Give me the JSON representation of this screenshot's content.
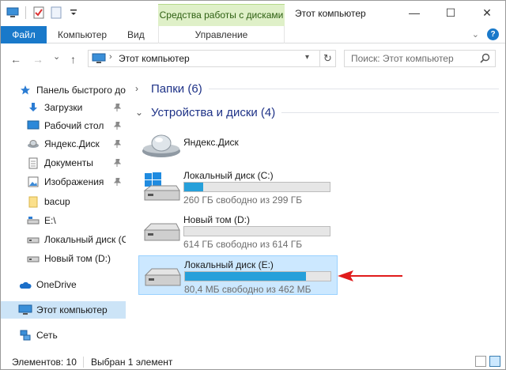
{
  "window": {
    "title": "Этот компьютер",
    "minimize": "—",
    "maximize": "☐",
    "close": "✕"
  },
  "quick_access_toolbar": {
    "icons": [
      "computer-icon",
      "properties-icon",
      "new-folder-icon",
      "customize-dropdown-icon"
    ]
  },
  "ribbon": {
    "contextual_group": "Средства работы с дисками",
    "tabs": {
      "file": "Файл",
      "computer": "Компьютер",
      "view": "Вид",
      "manage": "Управление"
    },
    "accent_color": "#1979ca",
    "contextual_color": "#dff0c8"
  },
  "navigation": {
    "back": "←",
    "forward": "→",
    "recent": "⌄",
    "up": "↑",
    "address": "Этот компьютер",
    "separator": "›",
    "refresh": "↻",
    "search_placeholder": "Поиск: Этот компьютер"
  },
  "sidebar": {
    "items": [
      {
        "label": "Панель быстрого до",
        "icon": "star-icon",
        "pinned": false
      },
      {
        "label": "Загрузки",
        "icon": "downloads-icon",
        "pinned": true
      },
      {
        "label": "Рабочий стол",
        "icon": "desktop-icon",
        "pinned": true
      },
      {
        "label": "Яндекс.Диск",
        "icon": "yandex-disk-icon",
        "pinned": true
      },
      {
        "label": "Документы",
        "icon": "documents-icon",
        "pinned": true
      },
      {
        "label": "Изображения",
        "icon": "pictures-icon",
        "pinned": true
      },
      {
        "label": "bacup",
        "icon": "folder-icon",
        "pinned": false
      },
      {
        "label": "E:\\",
        "icon": "drive-icon",
        "pinned": false
      },
      {
        "label": "Локальный диск (С",
        "icon": "drive-icon",
        "pinned": false
      },
      {
        "label": "Новый том (D:)",
        "icon": "drive-icon",
        "pinned": false
      },
      {
        "label": "OneDrive",
        "icon": "onedrive-icon",
        "pinned": false
      },
      {
        "label": "Этот компьютер",
        "icon": "computer-icon",
        "pinned": false,
        "selected": true
      },
      {
        "label": "Сеть",
        "icon": "network-icon",
        "pinned": false
      }
    ]
  },
  "main": {
    "groups": {
      "folders": "Папки (6)",
      "devices": "Устройства и диски (4)"
    },
    "drives": [
      {
        "name": "Яндекс.Диск",
        "type": "yandex-disk",
        "used_fraction": null,
        "free_text": ""
      },
      {
        "name": "Локальный диск (C:)",
        "type": "system",
        "used_fraction": 0.13,
        "free_text": "260 ГБ свободно из 299 ГБ"
      },
      {
        "name": "Новый том (D:)",
        "type": "hdd",
        "used_fraction": 0.0,
        "free_text": "614 ГБ свободно из 614 ГБ"
      },
      {
        "name": "Локальный диск (E:)",
        "type": "hdd",
        "used_fraction": 0.83,
        "free_text": "80,4 МБ свободно из 462 МБ",
        "selected": true
      }
    ],
    "annotation_color": "#e01b1b"
  },
  "status": {
    "items": "Элементов: 10",
    "selected": "Выбран 1 элемент"
  }
}
